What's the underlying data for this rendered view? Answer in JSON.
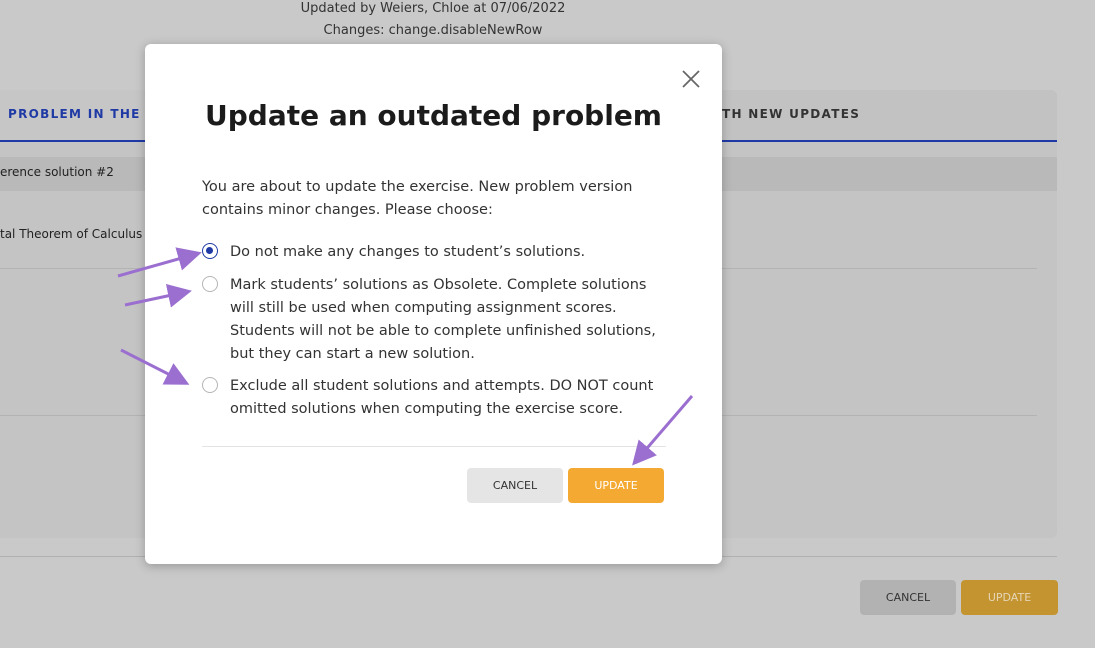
{
  "background": {
    "update_info": {
      "updated_by": "Updated by Weiers, Chloe at 07/06/2022",
      "changes": "Changes: change.disableNewRow"
    },
    "tabs": {
      "left_label": "PROBLEM IN THE",
      "right_label": "TH NEW UPDATES"
    },
    "subheader": "erence solution #2",
    "row_text": "tal Theorem of Calculus",
    "cancel_label": "CANCEL",
    "update_label": "UPDATE"
  },
  "modal": {
    "title": "Update an outdated problem",
    "intro": "You are about to update the exercise. New problem version contains minor changes. Please choose:",
    "options": [
      {
        "label": "Do not make any changes to student’s solutions.",
        "checked": true
      },
      {
        "label": "Mark students’ solutions as Obsolete. Complete solutions will still be used when computing assignment scores. Students will not be able to complete unfinished solutions, but they can start a new solution.",
        "checked": false
      },
      {
        "label": "Exclude all student solutions and attempts. DO NOT count omitted solutions when computing the exercise score.",
        "checked": false
      }
    ],
    "cancel_label": "CANCEL",
    "update_label": "UPDATE",
    "close_icon": "close-icon"
  },
  "colors": {
    "accent_blue": "#1f3aa5",
    "update_orange": "#f3a932",
    "annotation_purple": "#9b6fd0"
  }
}
